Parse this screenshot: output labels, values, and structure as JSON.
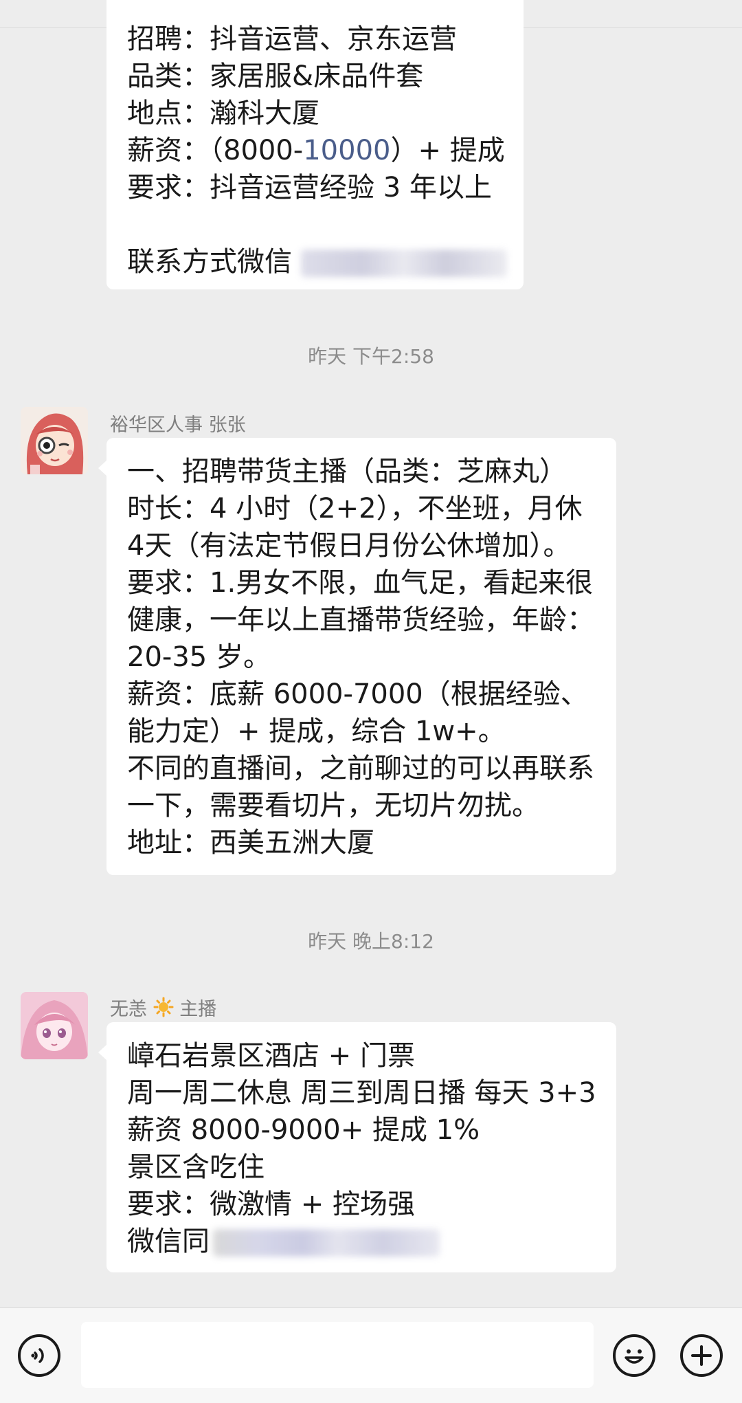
{
  "header": {
    "title_cut": "<        ·  ··  ·   (···)"
  },
  "messages": [
    {
      "lines": [
        "招聘：抖音运营、京东运营",
        "品类：家居服&床品件套",
        "地点：瀚科大厦",
        "",
        "要求：抖音运营经验 3 年以上",
        "",
        "联系方式微信"
      ],
      "salary_prefix": "薪资：（8000-",
      "salary_link": "10000",
      "salary_suffix": "）+ 提成"
    },
    {
      "sender": "裕华区人事 张张",
      "lines": [
        "一、招聘带货主播（品类：芝麻丸）",
        "时长：4 小时（2+2），不坐班，月休",
        "4天（有法定节假日月份公休增加）。",
        "要求：1.男女不限，血气足，看起来很",
        "健康，一年以上直播带货经验，年龄：",
        "20-35 岁。",
        "薪资：底薪 6000-7000（根据经验、",
        "能力定）+ 提成，综合 1w+。",
        "不同的直播间，之前聊过的可以再联系",
        "一下，需要看切片，无切片勿扰。",
        "地址：西美五洲大厦"
      ]
    },
    {
      "sender_name": "无恙",
      "sender_role": "主播",
      "lines": [
        "嶂石岩景区酒店 + 门票",
        "周一周二休息 周三到周日播 每天 3+3",
        "薪资 8000-9000+ 提成 1%",
        "景区含吃住",
        "要求：微激情 + 控场强",
        "微信同"
      ]
    }
  ],
  "timestamps": [
    "昨天 下午2:58",
    "昨天 晚上8:12"
  ],
  "input": {
    "value": ""
  },
  "icons": {
    "voice": "voice-icon",
    "emoji": "emoji-icon",
    "plus": "plus-icon",
    "sun": "sun-icon"
  },
  "colors": {
    "background": "#ededed",
    "bubble": "#ffffff",
    "link": "#4a5d8a",
    "timestamp": "#8c8c8c"
  }
}
